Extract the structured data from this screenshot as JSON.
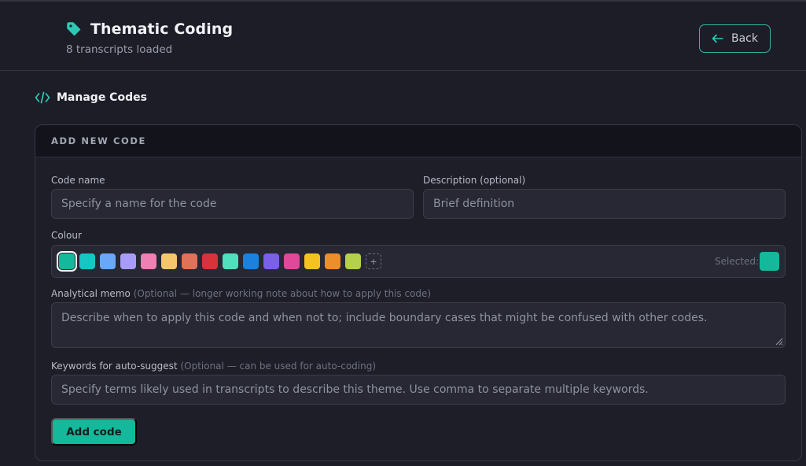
{
  "header": {
    "title": "Thematic Coding",
    "subtitle": "8 transcripts loaded",
    "back_label": "Back"
  },
  "section": {
    "title": "Manage Codes"
  },
  "card": {
    "heading": "ADD NEW CODE",
    "code_name": {
      "label": "Code name",
      "placeholder": "Specify a name for the code"
    },
    "description": {
      "label": "Description (optional)",
      "placeholder": "Brief definition"
    },
    "colour": {
      "label": "Colour",
      "swatches": [
        "#14b89a",
        "#16c6c4",
        "#6aa8f7",
        "#a79cf7",
        "#f07fb3",
        "#f6c66e",
        "#e0715a",
        "#d8323b",
        "#4fe0bd",
        "#1a82de",
        "#7a5fe8",
        "#e0499a",
        "#f4c221",
        "#ec8e2a",
        "#b5d04a"
      ],
      "selected_index": 0,
      "add_symbol": "+",
      "selected_label": "Selected:",
      "selected_color": "#14b89a"
    },
    "memo": {
      "label": "Analytical memo",
      "hint": "(Optional — longer working note about how to apply this code)",
      "placeholder": "Describe when to apply this code and when not to; include boundary cases that might be confused with other codes."
    },
    "keywords": {
      "label": "Keywords for auto-suggest",
      "hint": "(Optional — can be used for auto-coding)",
      "placeholder": "Specify terms likely used in transcripts to describe this theme. Use comma to separate multiple keywords."
    },
    "add_label": "Add code"
  },
  "colors": {
    "accent": "#2fb8a6",
    "button": "#14b89a"
  }
}
